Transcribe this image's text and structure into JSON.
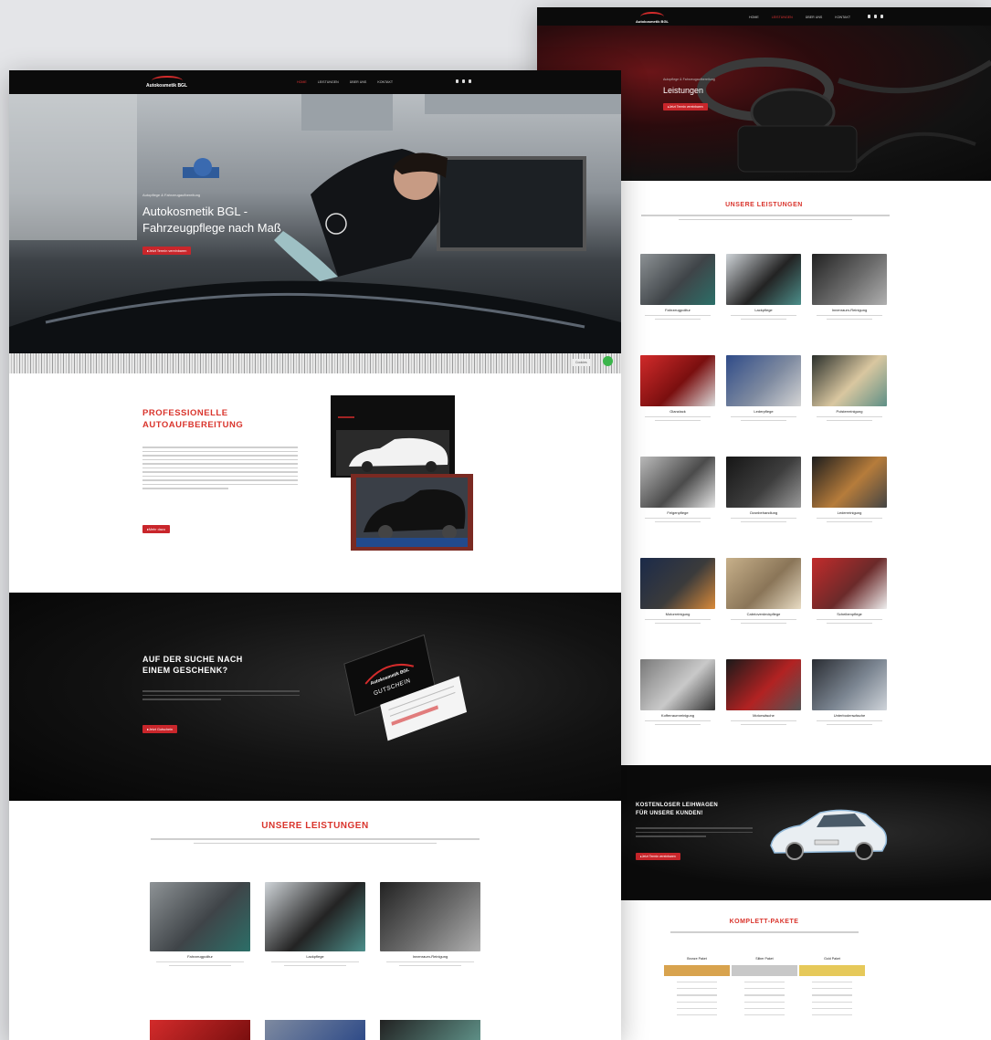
{
  "brand": {
    "logo_text": "Autokosmetik BGL",
    "accent_color": "#d32b2b",
    "dark_color": "#0b0b0b",
    "background": "#e4e5e8"
  },
  "front_page": {
    "nav": {
      "items": [
        {
          "label": "Home",
          "active": true
        },
        {
          "label": "Leistungen",
          "active": false
        },
        {
          "label": "Über uns",
          "active": false
        },
        {
          "label": "Kontakt",
          "active": false
        }
      ],
      "social_icons": [
        "facebook-icon",
        "instagram-icon",
        "phone-icon"
      ]
    },
    "hero": {
      "kicker": "Autopflege & Fahrzeugaufbereitung",
      "title_line1": "Autokosmetik BGL -",
      "title_line2": "Fahrzeugpflege nach Maß",
      "button": "Jetzt Termin vereinbaren",
      "cookie_label": "Cookies"
    },
    "intro": {
      "heading_line1": "PROFESSIONELLE",
      "heading_line2": "AUTOAUFBEREITUNG",
      "button": "Mehr dazu"
    },
    "gift": {
      "heading_line1": "AUF DER SUCHE NACH",
      "heading_line2": "EINEM GESCHENK?",
      "button": "Jetzt Gutschein",
      "voucher_brand": "Autokosmetik BGL",
      "voucher_title": "GUTSCHEIN"
    },
    "services": {
      "heading": "UNSERE LEISTUNGEN",
      "cards": [
        {
          "label": "Fahrzeugpolitur"
        },
        {
          "label": "Lackpflege"
        },
        {
          "label": "Innenraum-Reinigung"
        }
      ]
    }
  },
  "back_page": {
    "nav": {
      "items": [
        {
          "label": "Home",
          "active": false
        },
        {
          "label": "Leistungen",
          "active": true
        },
        {
          "label": "Über uns",
          "active": false
        },
        {
          "label": "Kontakt",
          "active": false
        }
      ]
    },
    "hero": {
      "kicker": "Autopflege & Fahrzeugaufbereitung",
      "title": "Leistungen",
      "button": "Jetzt Termin vereinbaren"
    },
    "services": {
      "heading": "UNSERE LEISTUNGEN",
      "cards": [
        {
          "label": "Fahrzeugpolitur"
        },
        {
          "label": "Lackpflege"
        },
        {
          "label": "Innenraum-Reinigung"
        },
        {
          "label": "Glanzlack"
        },
        {
          "label": "Lederpflege"
        },
        {
          "label": "Polsterreinigung"
        },
        {
          "label": "Felgenpflege"
        },
        {
          "label": "Ozonbehandlung"
        },
        {
          "label": "Lederreinigung"
        },
        {
          "label": "Motorreinigung"
        },
        {
          "label": "Cabrioverdeckpflege"
        },
        {
          "label": "Scheibenpflege"
        },
        {
          "label": "Kofferraumreinigung"
        },
        {
          "label": "Motorwäsche"
        },
        {
          "label": "Unterbodenwäsche"
        }
      ]
    },
    "loaner": {
      "heading_line1": "KOSTENLOSER LEIHWAGEN",
      "heading_line2": "FÜR UNSERE KUNDEN!",
      "button": "Jetzt Termin vereinbaren"
    },
    "packages": {
      "heading": "KOMPLETT-PAKETE",
      "columns": [
        {
          "name": "Bronze Paket",
          "color": "#d8a34e"
        },
        {
          "name": "Silber Paket",
          "color": "#c8c8c8"
        },
        {
          "name": "Gold Paket",
          "color": "#e6c95a"
        }
      ]
    }
  }
}
